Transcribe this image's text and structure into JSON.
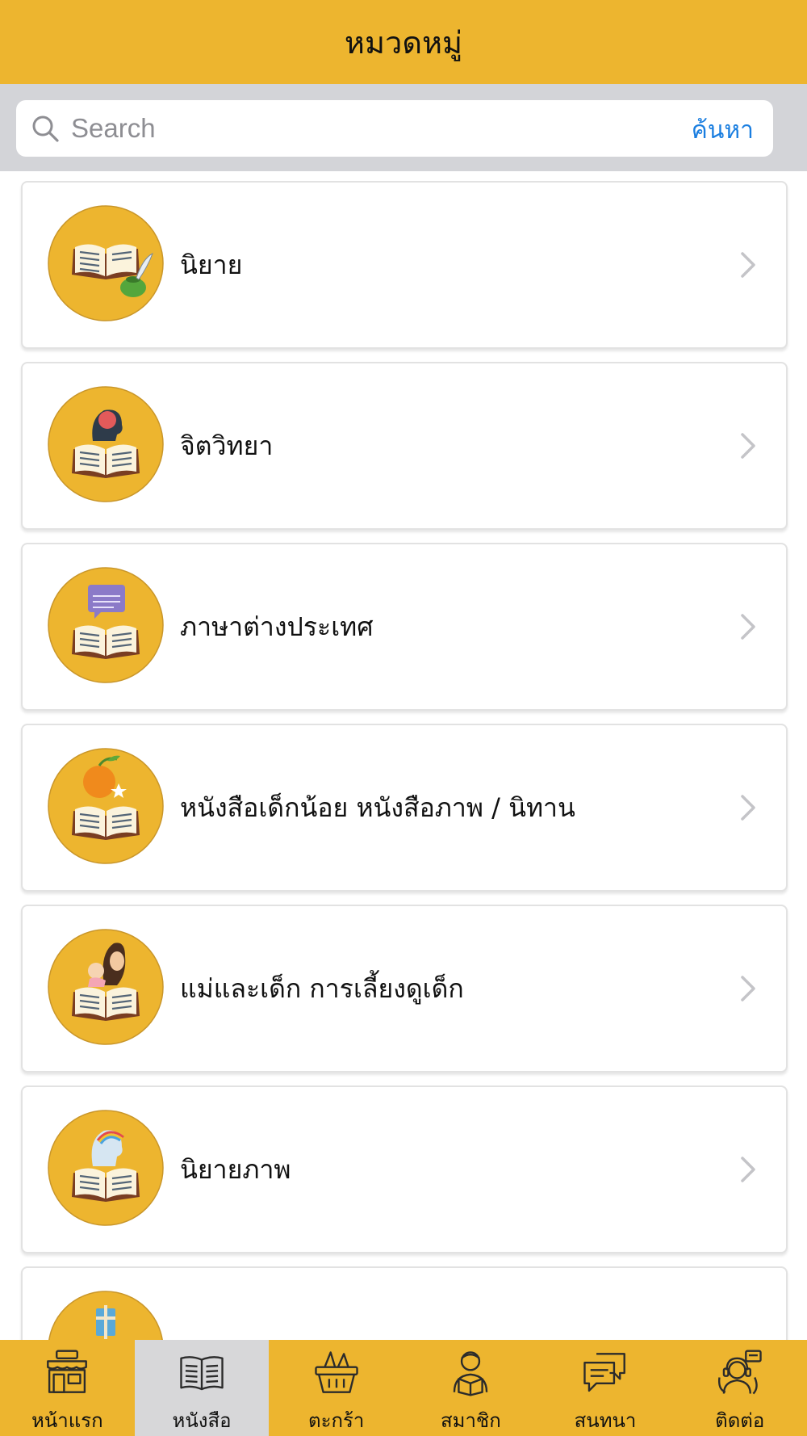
{
  "header": {
    "title": "หมวดหมู่"
  },
  "search": {
    "placeholder": "Search",
    "value": "",
    "button_label": "ค้นหา"
  },
  "categories": [
    {
      "label": "นิยาย",
      "icon": "book-quill-icon"
    },
    {
      "label": "จิตวิทยา",
      "icon": "book-brain-icon"
    },
    {
      "label": "ภาษาต่างประเทศ",
      "icon": "book-translate-icon"
    },
    {
      "label": "หนังสือเด็กน้อย หนังสือภาพ / นิทาน",
      "icon": "book-fruit-icon"
    },
    {
      "label": "แม่และเด็ก การเลี้ยงดูเด็ก",
      "icon": "book-mother-child-icon"
    },
    {
      "label": "นิยายภาพ",
      "icon": "book-rainbow-head-icon"
    },
    {
      "label": "",
      "icon": "book-cross-icon"
    }
  ],
  "tabbar": {
    "active_index": 1,
    "tabs": [
      {
        "label": "หน้าแรก",
        "icon": "storefront-icon"
      },
      {
        "label": "หนังสือ",
        "icon": "open-book-icon"
      },
      {
        "label": "ตะกร้า",
        "icon": "basket-icon"
      },
      {
        "label": "สมาชิก",
        "icon": "member-reading-icon"
      },
      {
        "label": "สนทนา",
        "icon": "chat-bubbles-icon"
      },
      {
        "label": "ติดต่อ",
        "icon": "support-agent-icon"
      }
    ]
  },
  "colors": {
    "brand": "#EDB52F",
    "link": "#1A7EE0",
    "searchbar_bg": "#D3D4D8",
    "active_tab": "#D7D7D9"
  }
}
